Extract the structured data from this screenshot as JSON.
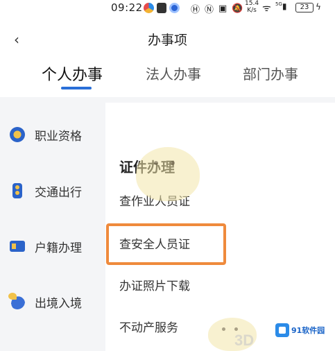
{
  "status_bar": {
    "time": "09:22",
    "net_speed_value": "15.4",
    "net_speed_unit": "K/s",
    "signal": "5G",
    "battery": "23"
  },
  "header": {
    "back_glyph": "‹",
    "title": "办事项"
  },
  "tabs": [
    {
      "label": "个人办事",
      "active": true
    },
    {
      "label": "法人办事",
      "active": false
    },
    {
      "label": "部门办事",
      "active": false
    }
  ],
  "sidebar": {
    "items": [
      {
        "label": "职业资格",
        "icon": "qualification-icon"
      },
      {
        "label": "交通出行",
        "icon": "traffic-light-icon"
      },
      {
        "label": "户籍办理",
        "icon": "id-card-icon"
      },
      {
        "label": "出境入境",
        "icon": "globe-plane-icon"
      }
    ]
  },
  "content": {
    "section_title": "证件办理",
    "items": [
      {
        "label": "查作业人员证"
      },
      {
        "label": "查安全人员证",
        "highlighted": true
      },
      {
        "label": "办证照片下载"
      },
      {
        "label": "不动产服务"
      }
    ],
    "highlight_color": "#ef8a3c"
  },
  "watermark": {
    "logo_text": "91软件园",
    "text_3d": "3D"
  },
  "colors": {
    "accent": "#2a6fd8",
    "sidebar_bg": "#f4f5f7"
  }
}
